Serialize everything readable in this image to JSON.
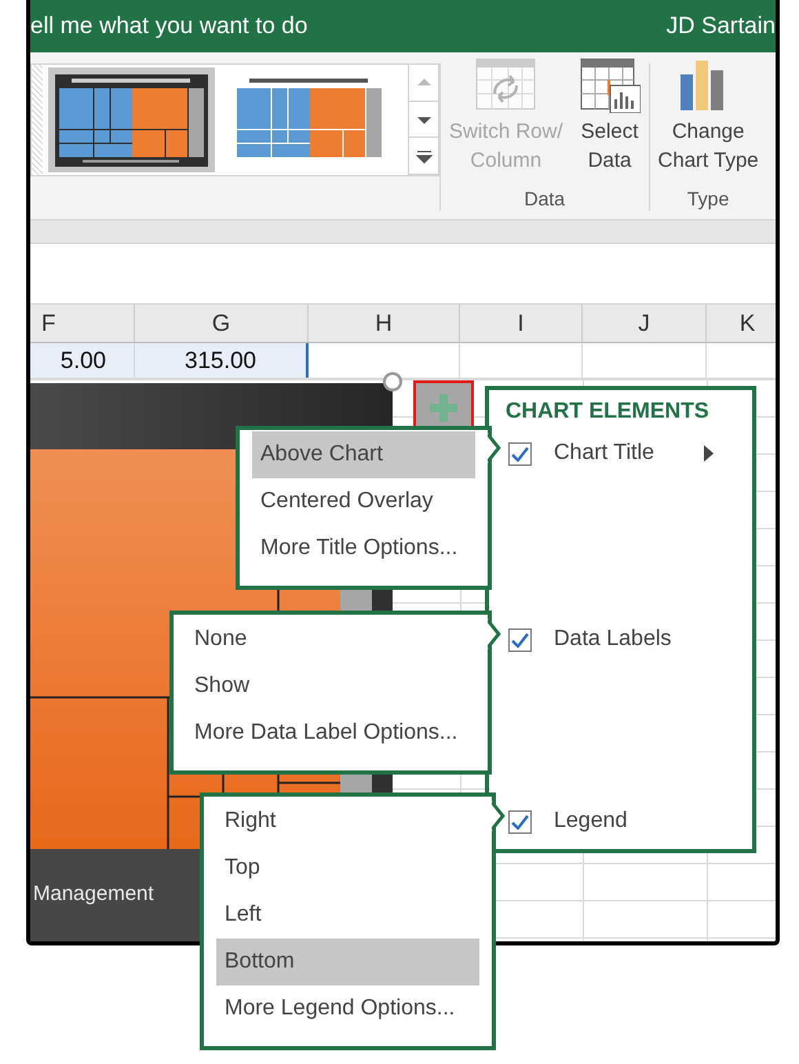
{
  "title_bar": {
    "search_prompt": "ell me what you want to do",
    "user": "JD Sartain"
  },
  "ribbon": {
    "styles": [
      {
        "kind": "dark",
        "selected": true
      },
      {
        "kind": "light",
        "selected": false
      }
    ],
    "groups": [
      {
        "label": "Data",
        "buttons": [
          {
            "kind": "switch",
            "lines": [
              "Switch Row/",
              "Column"
            ],
            "disabled": true
          },
          {
            "kind": "select",
            "lines": [
              "Select",
              "Data"
            ],
            "disabled": false
          }
        ]
      },
      {
        "label": "Type",
        "buttons": [
          {
            "kind": "charttype",
            "lines": [
              "Change",
              "Chart Type"
            ],
            "disabled": false
          }
        ]
      }
    ]
  },
  "sheet": {
    "columns": [
      "F",
      "G",
      "H",
      "I",
      "J",
      "K"
    ],
    "row": [
      {
        "text": "5.00",
        "selected": true
      },
      {
        "text": "315.00",
        "selected": true
      }
    ]
  },
  "chart": {
    "legend_label": "Management"
  },
  "chart_elements": {
    "title": "CHART ELEMENTS",
    "items": [
      {
        "label": "Chart Title",
        "checked": true,
        "has_arrow": true,
        "menu": [
          {
            "label": "Above Chart",
            "selected": true
          },
          {
            "label": "Centered Overlay",
            "selected": false
          },
          {
            "label": "More Title Options...",
            "selected": false
          }
        ]
      },
      {
        "label": "Data Labels",
        "checked": true,
        "has_arrow": false,
        "menu": [
          {
            "label": "None",
            "selected": false
          },
          {
            "label": "Show",
            "selected": false
          },
          {
            "label": "More Data Label Options...",
            "selected": false
          }
        ]
      },
      {
        "label": "Legend",
        "checked": true,
        "has_arrow": false,
        "menu": [
          {
            "label": "Right",
            "selected": false
          },
          {
            "label": "Top",
            "selected": false
          },
          {
            "label": "Left",
            "selected": false
          },
          {
            "label": "Bottom",
            "selected": true
          },
          {
            "label": "More Legend Options...",
            "selected": false
          }
        ]
      }
    ]
  }
}
